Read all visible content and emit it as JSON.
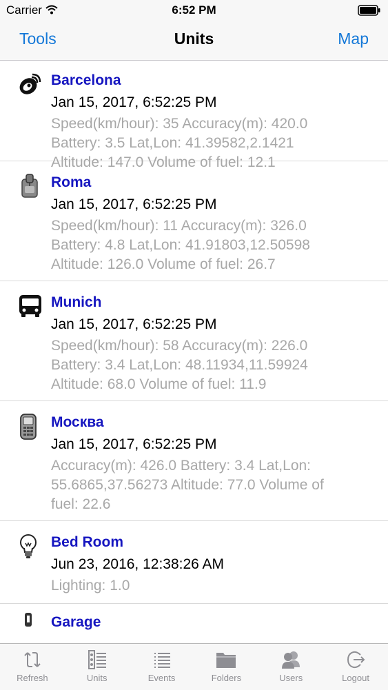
{
  "status_bar": {
    "carrier": "Carrier",
    "time": "6:52 PM"
  },
  "nav": {
    "left": "Tools",
    "title": "Units",
    "right": "Map"
  },
  "units": [
    {
      "icon": "satellite-dish-icon",
      "name": "Barcelona",
      "date": "Jan 15, 2017, 6:52:25 PM",
      "details": [
        "Speed(km/hour): 35 Accuracy(m): 420.0",
        "Battery: 3.5 Lat,Lon: 41.39582,2.1421",
        "Altitude: 147.0 Volume of fuel: 12.1"
      ]
    },
    {
      "icon": "gps-tracker-icon",
      "name": "Roma",
      "date": "Jan 15, 2017, 6:52:25 PM",
      "details": [
        "Speed(km/hour): 11 Accuracy(m): 326.0",
        "Battery: 4.8 Lat,Lon: 41.91803,12.50598",
        "Altitude: 126.0 Volume of fuel: 26.7"
      ]
    },
    {
      "icon": "bus-icon",
      "name": "Munich",
      "date": "Jan 15, 2017, 6:52:25 PM",
      "details": [
        "Speed(km/hour): 58 Accuracy(m): 226.0",
        "Battery: 3.4 Lat,Lon: 48.11934,11.59924",
        "Altitude: 68.0 Volume of fuel: 11.9"
      ]
    },
    {
      "icon": "mobile-phone-icon",
      "name": "Москва",
      "date": "Jan 15, 2017, 6:52:25 PM",
      "details": [
        "Accuracy(m): 426.0 Battery: 3.4 Lat,Lon:",
        "55.6865,37.56273 Altitude: 77.0 Volume of",
        "fuel: 22.6"
      ]
    },
    {
      "icon": "light-bulb-icon",
      "name": "Bed Room",
      "date": "Jun 23, 2016, 12:38:26 AM",
      "details": [
        "Lighting: 1.0"
      ]
    },
    {
      "icon": "plug-icon",
      "name": "Garage",
      "date": "",
      "details": []
    }
  ],
  "tabs": [
    {
      "label": "Refresh",
      "icon": "refresh-icon"
    },
    {
      "label": "Units",
      "icon": "units-icon"
    },
    {
      "label": "Events",
      "icon": "events-icon"
    },
    {
      "label": "Folders",
      "icon": "folder-icon"
    },
    {
      "label": "Users",
      "icon": "users-icon"
    },
    {
      "label": "Logout",
      "icon": "logout-icon"
    }
  ]
}
